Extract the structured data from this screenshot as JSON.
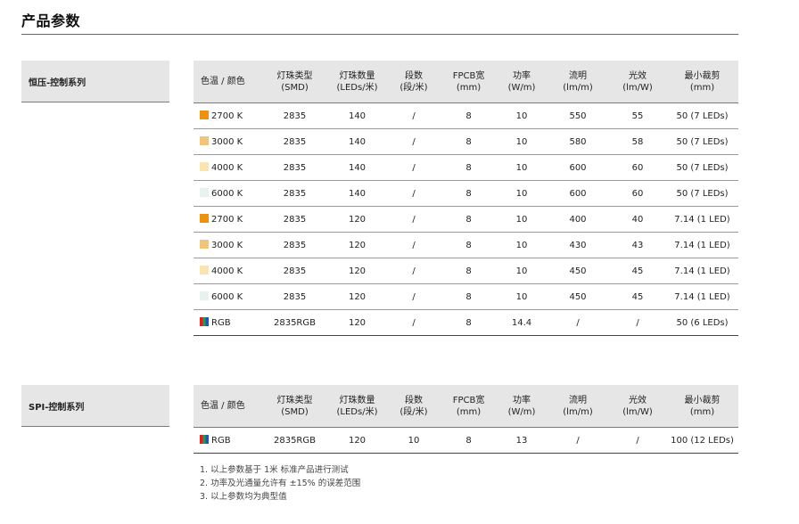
{
  "page_title": "产品参数",
  "headers": {
    "color": "色温 / 颜色",
    "led_type": [
      "灯珠类型",
      "(SMD)"
    ],
    "led_qty": [
      "灯珠数量",
      "(LEDs/米)"
    ],
    "segments": [
      "段数",
      "(段/米)"
    ],
    "fpcb": [
      "FPCB宽",
      "(mm)"
    ],
    "power": [
      "功率",
      "(W/m)"
    ],
    "flux": [
      "流明",
      "(lm/m)"
    ],
    "efficacy": [
      "光效",
      "(lm/W)"
    ],
    "min_cut": [
      "最小裁剪",
      "(mm)"
    ]
  },
  "series": [
    {
      "label": "恒压-控制系列",
      "rows": [
        {
          "color": "2700 K",
          "swatch": "#f0900c",
          "led_type": "2835",
          "led_qty": "140",
          "segments": "/",
          "fpcb": "8",
          "power": "10",
          "flux": "550",
          "efficacy": "55",
          "min_cut": "50 (7 LEDs)"
        },
        {
          "color": "3000 K",
          "swatch": "#f2c57a",
          "led_type": "2835",
          "led_qty": "140",
          "segments": "/",
          "fpcb": "8",
          "power": "10",
          "flux": "580",
          "efficacy": "58",
          "min_cut": "50 (7 LEDs)"
        },
        {
          "color": "4000 K",
          "swatch": "#fbe3b2",
          "led_type": "2835",
          "led_qty": "140",
          "segments": "/",
          "fpcb": "8",
          "power": "10",
          "flux": "600",
          "efficacy": "60",
          "min_cut": "50 (7 LEDs)"
        },
        {
          "color": "6000 K",
          "swatch": "#e7f1ef",
          "led_type": "2835",
          "led_qty": "140",
          "segments": "/",
          "fpcb": "8",
          "power": "10",
          "flux": "600",
          "efficacy": "60",
          "min_cut": "50 (7 LEDs)"
        },
        {
          "color": "2700 K",
          "swatch": "#f0900c",
          "led_type": "2835",
          "led_qty": "120",
          "segments": "/",
          "fpcb": "8",
          "power": "10",
          "flux": "400",
          "efficacy": "40",
          "min_cut": "7.14 (1 LED)"
        },
        {
          "color": "3000 K",
          "swatch": "#f2c57a",
          "led_type": "2835",
          "led_qty": "120",
          "segments": "/",
          "fpcb": "8",
          "power": "10",
          "flux": "430",
          "efficacy": "43",
          "min_cut": "7.14 (1 LED)"
        },
        {
          "color": "4000 K",
          "swatch": "#fbe3b2",
          "led_type": "2835",
          "led_qty": "120",
          "segments": "/",
          "fpcb": "8",
          "power": "10",
          "flux": "450",
          "efficacy": "45",
          "min_cut": "7.14 (1 LED)"
        },
        {
          "color": "6000 K",
          "swatch": "#e7f1ef",
          "led_type": "2835",
          "led_qty": "120",
          "segments": "/",
          "fpcb": "8",
          "power": "10",
          "flux": "450",
          "efficacy": "45",
          "min_cut": "7.14 (1 LED)"
        },
        {
          "color": "RGB",
          "swatch": "rgb",
          "led_type": "2835RGB",
          "led_qty": "120",
          "segments": "/",
          "fpcb": "8",
          "power": "14.4",
          "flux": "/",
          "efficacy": "/",
          "min_cut": "50 (6 LEDs)"
        }
      ]
    },
    {
      "label": "SPI-控制系列",
      "rows": [
        {
          "color": "RGB",
          "swatch": "rgb",
          "led_type": "2835RGB",
          "led_qty": "120",
          "segments": "10",
          "fpcb": "8",
          "power": "13",
          "flux": "/",
          "efficacy": "/",
          "min_cut": "100 (12 LEDs)"
        }
      ]
    }
  ],
  "notes": [
    "1. 以上参数基于 1米 标准产品进行测试",
    "2. 功率及光通量允许有 ±15% 的误差范围",
    "3. 以上参数均为典型值"
  ]
}
